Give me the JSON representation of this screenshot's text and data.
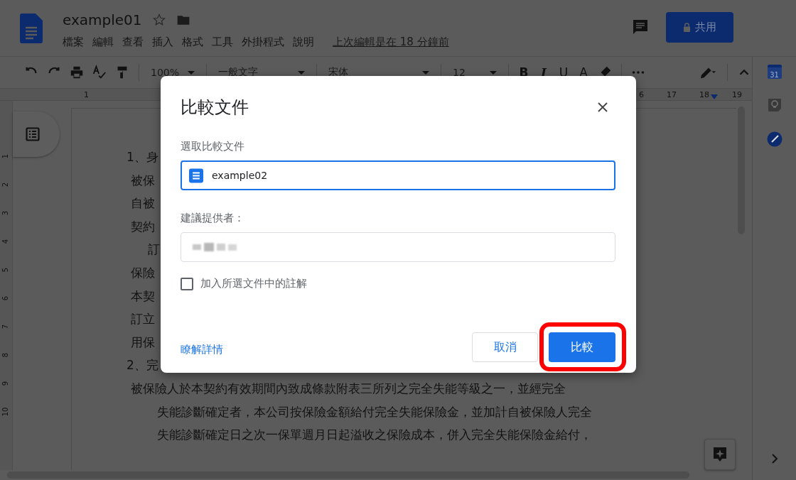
{
  "header": {
    "title": "example01",
    "menu": [
      "檔案",
      "編輯",
      "查看",
      "插入",
      "格式",
      "工具",
      "外掛程式",
      "說明"
    ],
    "last_edit": "上次編輯是在 18 分鐘前",
    "share_button": "共用"
  },
  "toolbar": {
    "zoom": "100%",
    "style": "一般文字",
    "font": "宋体",
    "size": "12",
    "format_buttons": [
      "B",
      "I",
      "U",
      "A"
    ]
  },
  "ruler": {
    "left_marks": [
      "1"
    ],
    "right_marks": [
      "6",
      "17",
      "18",
      "19"
    ],
    "vertical_marks": [
      "1",
      "2",
      "3",
      "4",
      "5",
      "6",
      "7",
      "8",
      "9",
      "10"
    ]
  },
  "side_panel": {
    "calendar_day": "31"
  },
  "document": {
    "lines": [
      {
        "kind": "heading",
        "text": "1、身"
      },
      {
        "kind": "body",
        "text": "被保"
      },
      {
        "kind": "body",
        "text": "自被"
      },
      {
        "kind": "body",
        "text": "契約"
      },
      {
        "kind": "first_line",
        "text": "訂"
      },
      {
        "kind": "body",
        "text": "保險"
      },
      {
        "kind": "body",
        "text": "本契"
      },
      {
        "kind": "body",
        "text": "訂立"
      },
      {
        "kind": "body",
        "text": "用保"
      },
      {
        "kind": "heading",
        "text": "2、完"
      },
      {
        "kind": "body",
        "text": "被保險人於本契約有效期間內致成條款附表三所列之完全失能等級之一，並經完全"
      },
      {
        "kind": "hanging",
        "text": "失能診斷確定者，本公司按保險金額給付完全失能保險金，並加計自被保險人完全"
      },
      {
        "kind": "hanging",
        "text": "失能診斷確定日之次一保單週月日起溢收之保險成本，併入完全失能保險金給付，"
      }
    ]
  },
  "dialog": {
    "title": "比較文件",
    "select_label": "選取比較文件",
    "selected_document": "example02",
    "reviewer_label": "建議提供者：",
    "include_comments": {
      "label": "加入所選文件中的註解",
      "checked": false
    },
    "learn_more": "瞭解詳情",
    "cancel_button": "取消",
    "compare_button": {
      "label": "比較",
      "highlighted": true
    }
  }
}
